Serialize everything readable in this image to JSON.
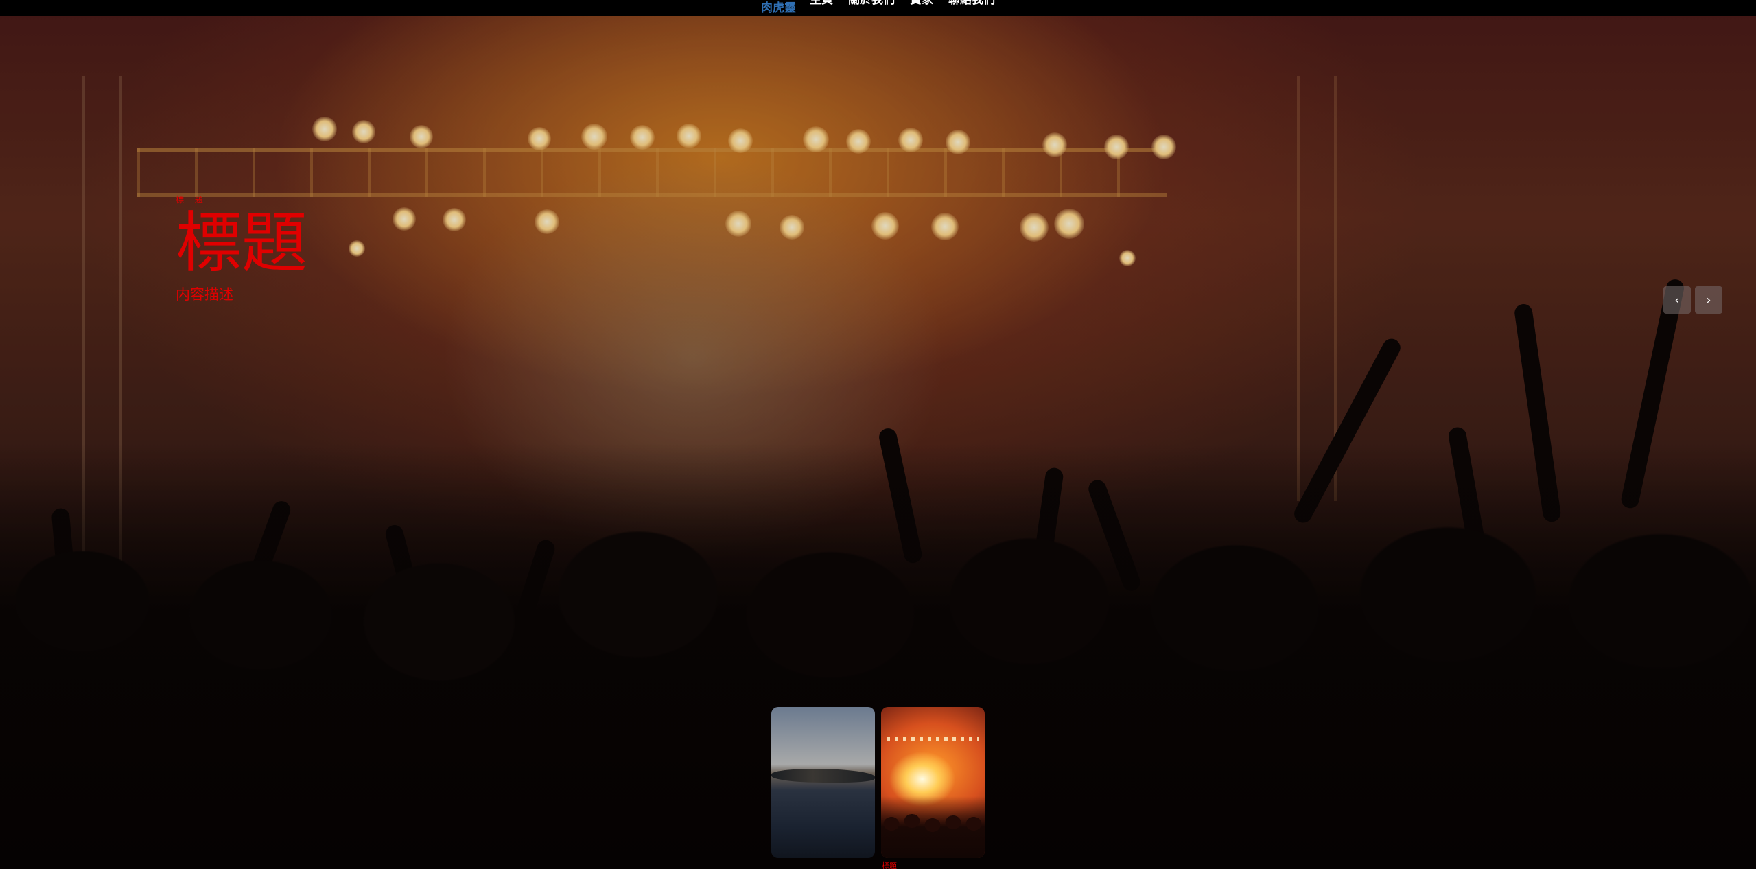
{
  "nav": {
    "brand": "肉虎靈",
    "links": [
      "主頁",
      "關於我們",
      "實家",
      "聯絡我們"
    ]
  },
  "hero": {
    "tag": "標 題",
    "title": "標題",
    "description": "内容描述",
    "prev_icon": "chevron-left-icon",
    "next_icon": "chevron-right-icon",
    "prev_glyph": "‹",
    "next_glyph": "›"
  },
  "thumbnails": [
    {
      "scene": "sea-shore"
    },
    {
      "scene": "concert-lights",
      "caption": "標題"
    }
  ],
  "colors": {
    "accent_red": "#e00000",
    "brand_blue": "#2f6fb3",
    "nav_bg": "#000000"
  }
}
